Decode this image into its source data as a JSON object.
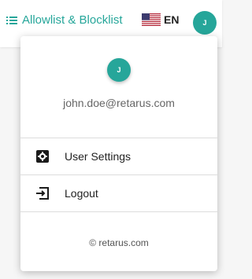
{
  "header": {
    "nav_label": "Allowlist & Blocklist",
    "language_label": "EN",
    "avatar_initial": "J"
  },
  "user_menu": {
    "avatar_initial": "J",
    "email": "john.doe@retarus.com",
    "items": [
      {
        "label": "User Settings",
        "icon": "gear-icon"
      },
      {
        "label": "Logout",
        "icon": "logout-icon"
      }
    ],
    "footer": "© retarus.com"
  },
  "colors": {
    "accent": "#26a69a",
    "text": "#222222",
    "muted": "#666666"
  }
}
